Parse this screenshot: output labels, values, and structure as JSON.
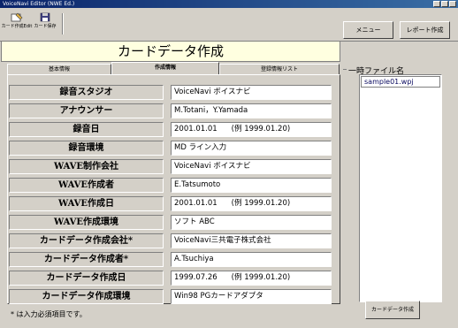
{
  "window": {
    "title": "VoiceNavi Editor (NWE Ed.)"
  },
  "toolbar": {
    "btn1_label": "カード作成Edit",
    "btn2_label": "カード保存",
    "menu_label": "メニュー",
    "report_label": "レポート作成"
  },
  "header": {
    "title": "カードデータ作成"
  },
  "tabs": [
    {
      "label": "基本情報"
    },
    {
      "label": "作成情報"
    },
    {
      "label": "登録情報リスト"
    }
  ],
  "fields": [
    {
      "label": "録音スタジオ",
      "value": "VoiceNavi ボイスナビ",
      "example": ""
    },
    {
      "label": "アナウンサー",
      "value": "M.Totani，Y.Yamada",
      "example": ""
    },
    {
      "label": "録音日",
      "value": "2001.01.01",
      "example": "(例 1999.01.20)"
    },
    {
      "label": "録音環境",
      "value": "MD ライン入力",
      "example": ""
    },
    {
      "label": "WAVE制作会社",
      "value": "VoiceNavi ボイスナビ",
      "example": ""
    },
    {
      "label": "WAVE作成者",
      "value": "E.Tatsumoto",
      "example": ""
    },
    {
      "label": "WAVE作成日",
      "value": "2001.01.01",
      "example": "(例 1999.01.20)"
    },
    {
      "label": "WAVE作成環境",
      "value": "ソフト ABC",
      "example": ""
    },
    {
      "label": "カードデータ作成会社*",
      "value": "VoiceNavi三共電子株式会社",
      "example": ""
    },
    {
      "label": "カードデータ作成者*",
      "value": "A.Tsuchiya",
      "example": ""
    },
    {
      "label": "カードデータ作成日",
      "value": "1999.07.26",
      "example": "(例 1999.01.20)"
    },
    {
      "label": "カードデータ作成環境",
      "value": "Win98 PGカードアダプタ",
      "example": ""
    }
  ],
  "note": "* は入力必須項目です。",
  "side": {
    "label": "一時ファイル名",
    "files": [
      "sample01.wpj"
    ],
    "create_label": "カードデータ作成"
  }
}
